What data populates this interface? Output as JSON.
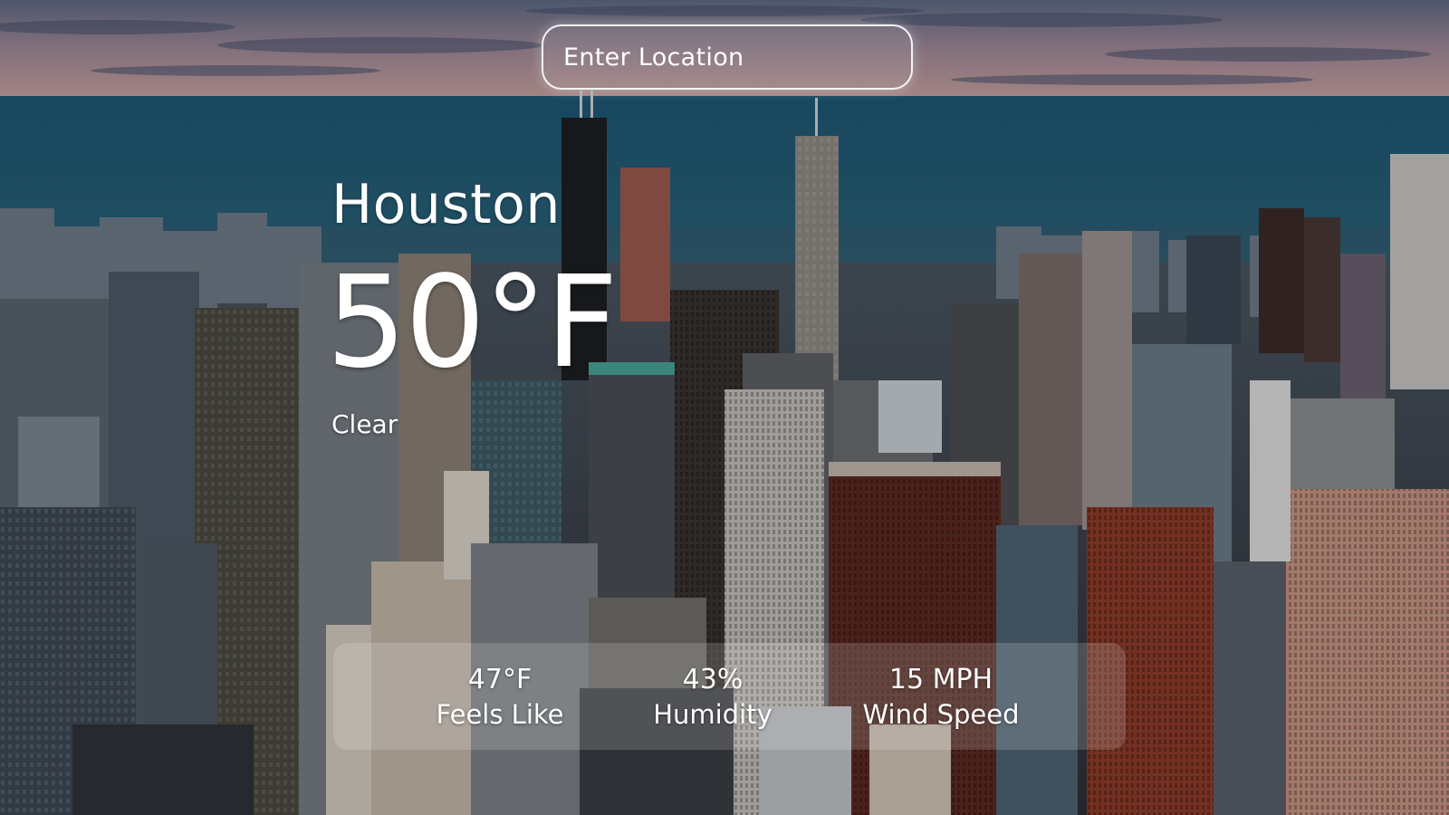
{
  "search": {
    "placeholder": "Enter Location"
  },
  "current": {
    "city": "Houston",
    "temperature": "50°F",
    "condition": "Clear"
  },
  "stats": {
    "feels_like": {
      "value": "47°F",
      "label": "Feels Like"
    },
    "humidity": {
      "value": "43%",
      "label": "Humidity"
    },
    "wind_speed": {
      "value": "15 MPH",
      "label": "Wind Speed"
    }
  },
  "background": {
    "description_icon": "city-skyline-photo",
    "sky_color": "#8a7d90",
    "water_color": "#1f4a63"
  }
}
